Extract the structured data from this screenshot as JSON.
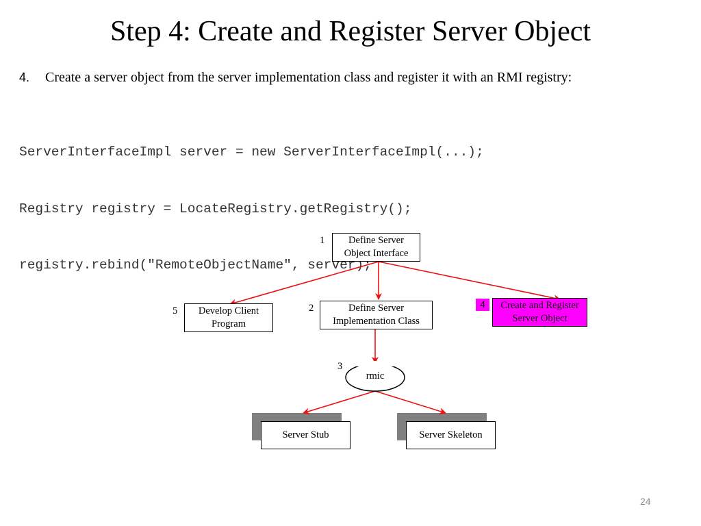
{
  "slide": {
    "title": "Step 4: Create and Register Server Object",
    "bullet": {
      "number": "4.",
      "text": "Create a server object from the server implementation class and register it with an RMI registry:"
    },
    "code_lines": [
      "ServerInterfaceImpl server = new ServerInterfaceImpl(...);",
      "Registry registry = LocateRegistry.getRegistry();",
      "registry.rebind(\"RemoteObjectName\", server);"
    ],
    "page_number": "24"
  },
  "diagram": {
    "colors": {
      "arrow": "#ee1111",
      "highlight": "#ff00ff",
      "shadow": "#808080"
    },
    "nodes": {
      "define_interface": {
        "step": "1",
        "lines": [
          "Define Server",
          "Object Interface"
        ]
      },
      "define_impl": {
        "step": "2",
        "lines": [
          "Define Server",
          "Implementation Class"
        ]
      },
      "rmic": {
        "step": "3",
        "label": "rmic"
      },
      "create_register": {
        "step": "4",
        "lines": [
          "Create and Register",
          "Server Object"
        ],
        "highlighted": true
      },
      "develop_client": {
        "step": "5",
        "lines": [
          "Develop Client",
          "Program"
        ]
      },
      "server_stub": {
        "label": "Server Stub"
      },
      "server_skeleton": {
        "label": "Server Skeleton"
      }
    },
    "edges": [
      {
        "from": "define_interface",
        "to": "develop_client"
      },
      {
        "from": "define_interface",
        "to": "define_impl"
      },
      {
        "from": "define_interface",
        "to": "create_register"
      },
      {
        "from": "define_impl",
        "to": "rmic"
      },
      {
        "from": "rmic",
        "to": "server_stub"
      },
      {
        "from": "rmic",
        "to": "server_skeleton"
      }
    ]
  }
}
